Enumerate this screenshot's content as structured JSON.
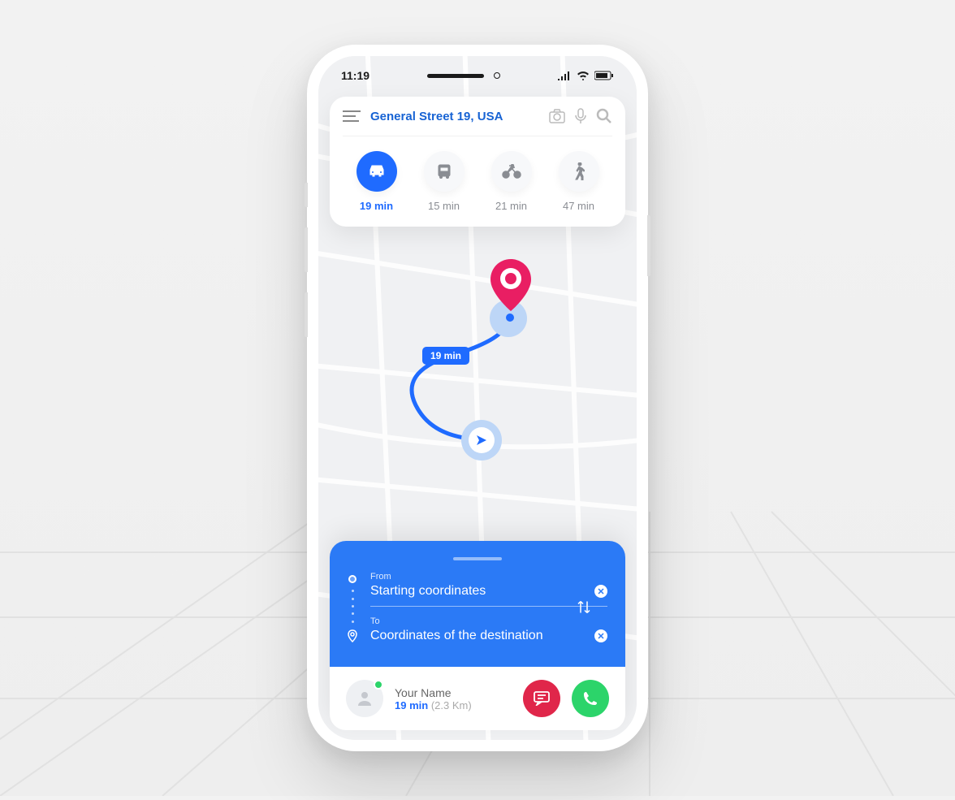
{
  "statusbar": {
    "time": "11:19"
  },
  "search": {
    "query": "General Street 19, USA"
  },
  "transport": [
    {
      "mode": "car",
      "time": "19 min",
      "active": true
    },
    {
      "mode": "bus",
      "time": "15 min",
      "active": false
    },
    {
      "mode": "bike",
      "time": "21 min",
      "active": false
    },
    {
      "mode": "walk",
      "time": "47 min",
      "active": false
    }
  ],
  "route": {
    "label": "19 min",
    "from_label": "From",
    "from_value": "Starting coordinates",
    "to_label": "To",
    "to_value": "Coordinates of the destination"
  },
  "driver": {
    "name": "Your Name",
    "time": "19 min",
    "distance": "(2.3 Km)"
  },
  "colors": {
    "primary": "#1f6bff",
    "accent_pink": "#e91e63",
    "chat_red": "#e0264a",
    "call_green": "#2cd46a"
  }
}
